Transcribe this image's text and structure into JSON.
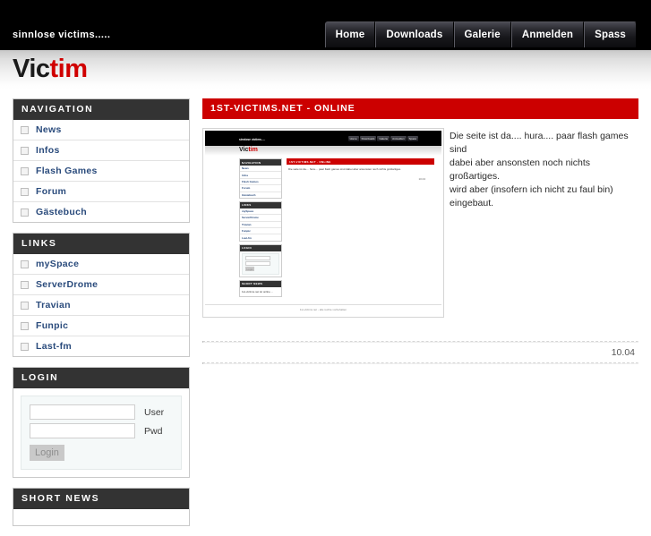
{
  "site": {
    "tagline": "sinnlose victims.....",
    "logo_part1": "Vic",
    "logo_part2": "tim",
    "accent_red": "#cc0000",
    "header_black": "#000000",
    "panel_header_gray": "#333333",
    "link_blue": "#2a4b7c"
  },
  "mainnav": {
    "items": [
      {
        "label": "Home"
      },
      {
        "label": "Downloads"
      },
      {
        "label": "Galerie"
      },
      {
        "label": "Anmelden"
      },
      {
        "label": "Spass"
      }
    ]
  },
  "sidebar": {
    "panels": [
      {
        "title": "NAVIGATION",
        "items": [
          {
            "label": "News",
            "icon": "bullet-square-icon"
          },
          {
            "label": "Infos",
            "icon": "bullet-square-icon"
          },
          {
            "label": "Flash Games",
            "icon": "bullet-square-icon"
          },
          {
            "label": "Forum",
            "icon": "bullet-square-icon"
          },
          {
            "label": "Gästebuch",
            "icon": "bullet-square-icon"
          }
        ]
      },
      {
        "title": "LINKS",
        "items": [
          {
            "label": "mySpace",
            "icon": "bullet-square-icon"
          },
          {
            "label": "ServerDrome",
            "icon": "bullet-square-icon"
          },
          {
            "label": "Travian",
            "icon": "bullet-square-icon"
          },
          {
            "label": "Funpic",
            "icon": "bullet-square-icon"
          },
          {
            "label": "Last-fm",
            "icon": "bullet-square-icon"
          }
        ]
      }
    ],
    "login": {
      "title": "LOGIN",
      "user_label": "User",
      "user_value": "",
      "user_placeholder": "",
      "pwd_label": "Pwd",
      "pwd_value": "",
      "pwd_placeholder": "",
      "button_label": "Login"
    },
    "shortnews": {
      "title": "SHORT NEWS"
    }
  },
  "main": {
    "article": {
      "title": "1ST-VICTIMS.NET - ONLINE",
      "body_line1": "Die seite ist da.... hura.... paar flash games sind",
      "body_line2": "dabei aber ansonsten noch nichts großartiges.",
      "body_line3": "wird aber (insofern ich nicht zu faul bin) eingebaut.",
      "date": "10.04",
      "thumbnail_alt": "screenshot-thumbnail"
    }
  },
  "thumbnail": {
    "tagline": "sinnlose victims.....",
    "logo_part1": "Vic",
    "logo_part2": "tim",
    "nav": [
      "Home",
      "Downloads",
      "Galerie",
      "Anmelden",
      "Spass"
    ],
    "panels": [
      {
        "title": "NAVIGATION",
        "items": [
          "News",
          "Infos",
          "Flash Games",
          "Forum",
          "Gästebuch"
        ]
      },
      {
        "title": "LINKS",
        "items": [
          "mySpace",
          "ServerDrome",
          "Travian",
          "Funpic",
          "Last-fm"
        ]
      }
    ],
    "login_title": "LOGIN",
    "login_button": "Login",
    "shortnews_title": "SHORT NEWS",
    "shortnews_text": "1st-victims.net ist online ...",
    "article_title": "1ST-VICTIMS.NET - ONLINE",
    "article_text": "Die seite ist da.... hura.... paar flash games sind dabei aber ansonsten noch nichts großartiges.",
    "article_date": "10.04",
    "footer": "1st-victims.net - alle rechte vorbehalten"
  }
}
